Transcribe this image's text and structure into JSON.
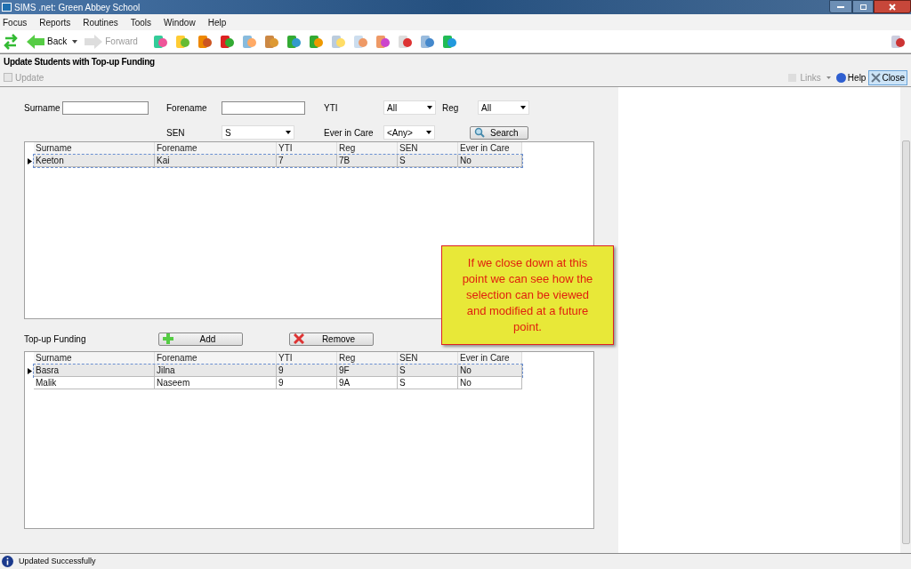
{
  "window": {
    "title": "SIMS .net: Green Abbey School"
  },
  "menu": [
    "Focus",
    "Reports",
    "Routines",
    "Tools",
    "Window",
    "Help"
  ],
  "toolbar": {
    "back": "Back",
    "forward": "Forward"
  },
  "page": {
    "title": "Update Students with Top-up Funding",
    "update": "Update",
    "links": "Links",
    "help": "Help",
    "close": "Close"
  },
  "search": {
    "surname": {
      "label": "Surname"
    },
    "forename": {
      "label": "Forename"
    },
    "yti": {
      "label": "YTI",
      "value": "All"
    },
    "reg": {
      "label": "Reg",
      "value": "All"
    },
    "sen": {
      "label": "SEN",
      "value": "S"
    },
    "ever_in_care": {
      "label": "Ever in Care",
      "value": "<Any>"
    },
    "search_button": "Search"
  },
  "results": {
    "columns": [
      "Surname",
      "Forename",
      "YTI",
      "Reg",
      "SEN",
      "Ever in Care"
    ],
    "rows": [
      {
        "cells": [
          "Keeton",
          "Kai",
          "7",
          "7B",
          "S",
          "No"
        ],
        "selected": true
      }
    ]
  },
  "topup": {
    "label": "Top-up Funding",
    "add": "Add",
    "remove": "Remove",
    "columns": [
      "Surname",
      "Forename",
      "YTI",
      "Reg",
      "SEN",
      "Ever in Care"
    ],
    "rows": [
      {
        "cells": [
          "Basra",
          "Jilna",
          "9",
          "9F",
          "S",
          "No"
        ],
        "selected": true
      },
      {
        "cells": [
          "Malik",
          "Naseem",
          "9",
          "9A",
          "S",
          "No"
        ],
        "selected": false
      }
    ]
  },
  "callout": "If we close down at this point we can see how the selection can be viewed and modified at a future point.",
  "status_bar": "Updated Successfully"
}
